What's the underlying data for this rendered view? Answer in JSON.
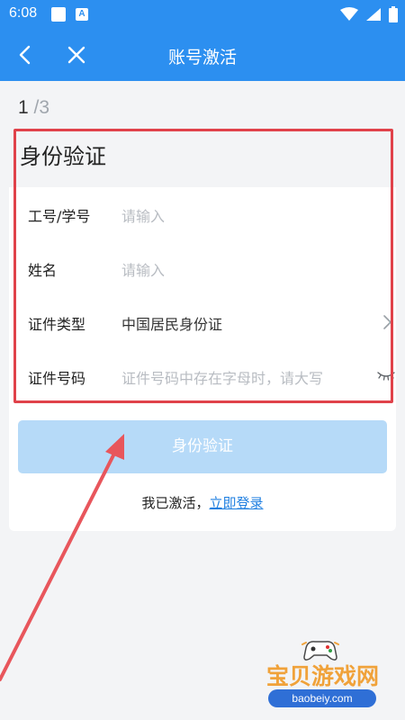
{
  "status_bar": {
    "time": "6:08",
    "app_badge": "A"
  },
  "nav": {
    "title": "账号激活"
  },
  "step": {
    "current": "1",
    "total": "/3"
  },
  "card": {
    "title": "身份验证",
    "fields": [
      {
        "label": "工号/学号",
        "placeholder": "请输入",
        "value": ""
      },
      {
        "label": "姓名",
        "placeholder": "请输入",
        "value": ""
      },
      {
        "label": "证件类型",
        "placeholder": "",
        "value": "中国居民身份证"
      },
      {
        "label": "证件号码",
        "placeholder": "证件号码中存在字母时，请大写",
        "value": ""
      }
    ]
  },
  "verify_button": {
    "label": "身份验证"
  },
  "login": {
    "text": "我已激活，",
    "link": "立即登录"
  },
  "watermark": {
    "title": "宝贝游戏网",
    "url": "baobeiy.com"
  },
  "colors": {
    "brand": "#2c8ff0",
    "button_disabled": "#b6daf8",
    "link": "#1f7fe0",
    "annotation": "#e0424a"
  }
}
